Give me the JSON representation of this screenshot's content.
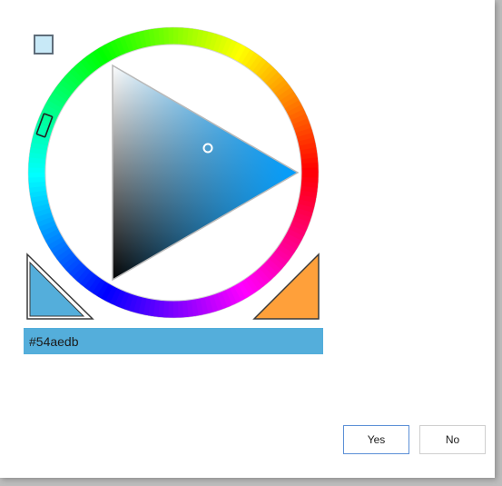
{
  "color_picker": {
    "hex_value": "#54aedb",
    "selected_color": "#54aedb",
    "previous_color": "#54aedb",
    "complement_color": "#ffa03a",
    "swatch_color": "#c8e9f7",
    "hue_color": "#009eff",
    "hue": 200
  },
  "buttons": {
    "yes_label": "Yes",
    "no_label": "No"
  }
}
